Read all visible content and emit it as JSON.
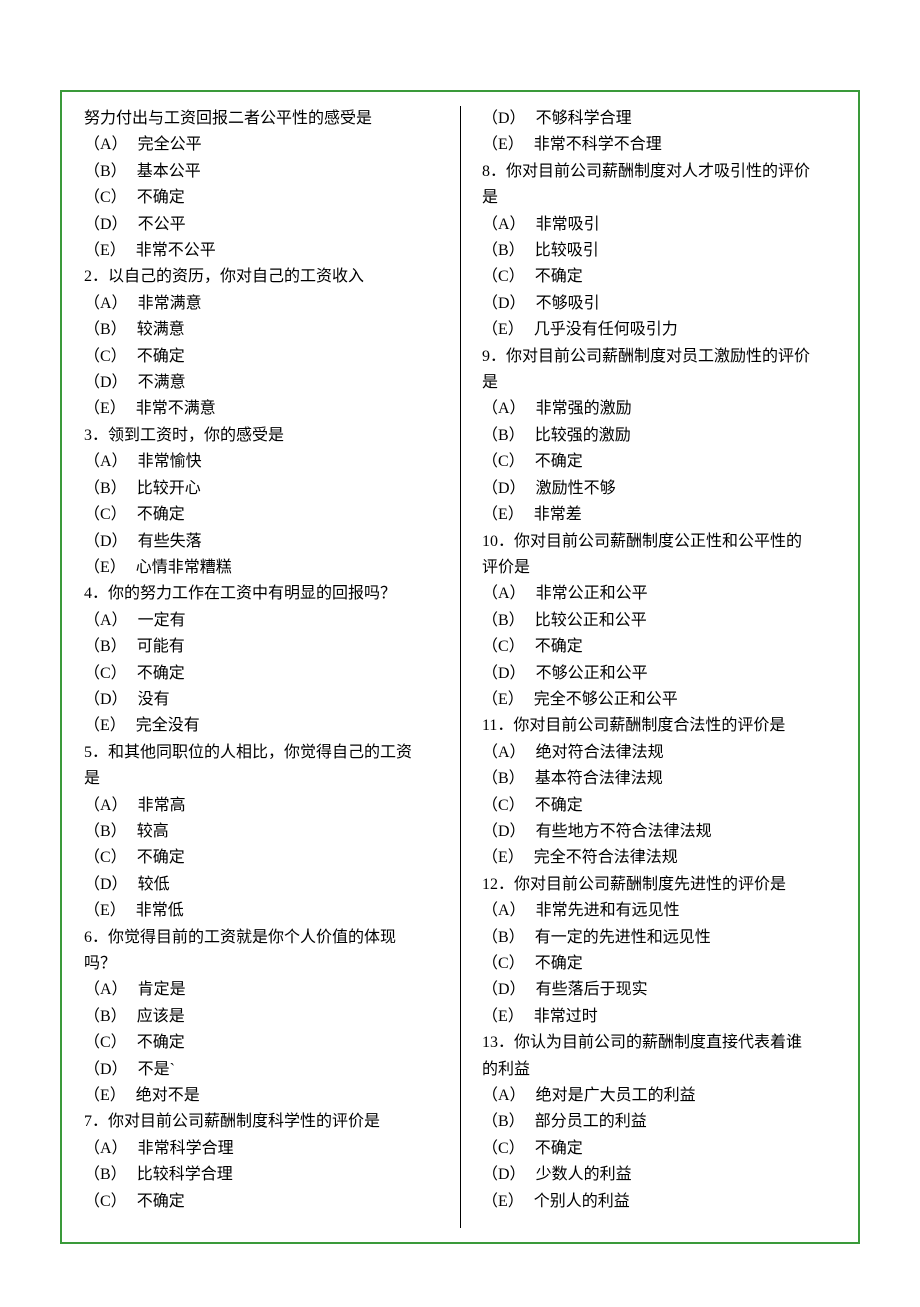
{
  "left": {
    "intro": "努力付出与工资回报二者公平性的感受是",
    "introOptions": [
      {
        "label": "（A）",
        "text": "完全公平"
      },
      {
        "label": "（B）",
        "text": "基本公平"
      },
      {
        "label": "（C）",
        "text": "不确定"
      },
      {
        "label": "（D）",
        "text": "不公平"
      },
      {
        "label": "（E）",
        "text": "非常不公平"
      }
    ],
    "q2": {
      "title": "2．以自己的资历，你对自己的工资收入",
      "options": [
        {
          "label": "（A）",
          "text": "非常满意"
        },
        {
          "label": "（B）",
          "text": "较满意"
        },
        {
          "label": "（C）",
          "text": "不确定"
        },
        {
          "label": "（D）",
          "text": "不满意"
        },
        {
          "label": "（E）",
          "text": "非常不满意"
        }
      ]
    },
    "q3": {
      "title": "3．领到工资时，你的感受是",
      "options": [
        {
          "label": "（A）",
          "text": "非常愉快"
        },
        {
          "label": "（B）",
          "text": "比较开心"
        },
        {
          "label": "（C）",
          "text": "不确定"
        },
        {
          "label": "（D）",
          "text": "有些失落"
        },
        {
          "label": "（E）",
          "text": "心情非常糟糕"
        }
      ]
    },
    "q4": {
      "title": "4．你的努力工作在工资中有明显的回报吗？",
      "options": [
        {
          "label": "（A）",
          "text": "一定有"
        },
        {
          "label": "（B）",
          "text": "可能有"
        },
        {
          "label": "（C）",
          "text": "不确定"
        },
        {
          "label": "（D）",
          "text": "没有"
        },
        {
          "label": "（E）",
          "text": "完全没有"
        }
      ]
    },
    "q5": {
      "title1": "5．和其他同职位的人相比，你觉得自己的工资",
      "title2": "是",
      "options": [
        {
          "label": "（A）",
          "text": "非常高"
        },
        {
          "label": "（B）",
          "text": "较高"
        },
        {
          "label": "（C）",
          "text": "不确定"
        },
        {
          "label": "（D）",
          "text": "较低"
        },
        {
          "label": "（E）",
          "text": "非常低"
        }
      ]
    },
    "q6": {
      "title1": "6．你觉得目前的工资就是你个人价值的体现",
      "title2": "吗？",
      "options": [
        {
          "label": "（A）",
          "text": "肯定是"
        },
        {
          "label": "（B）",
          "text": "应该是"
        },
        {
          "label": "（C）",
          "text": "不确定"
        },
        {
          "label": "（D）",
          "text": "不是`"
        },
        {
          "label": "（E）",
          "text": "绝对不是"
        }
      ]
    },
    "q7": {
      "title": "7．你对目前公司薪酬制度科学性的评价是",
      "options": [
        {
          "label": "（A）",
          "text": "非常科学合理"
        },
        {
          "label": "（B）",
          "text": "比较科学合理"
        },
        {
          "label": "（C）",
          "text": "不确定"
        }
      ]
    }
  },
  "right": {
    "q7cont": [
      {
        "label": "（D）",
        "text": "不够科学合理"
      },
      {
        "label": "（E）",
        "text": "非常不科学不合理"
      }
    ],
    "q8": {
      "title1": "8．你对目前公司薪酬制度对人才吸引性的评价",
      "title2": "是",
      "options": [
        {
          "label": "（A）",
          "text": "非常吸引"
        },
        {
          "label": "（B）",
          "text": "比较吸引"
        },
        {
          "label": "（C）",
          "text": "不确定"
        },
        {
          "label": "（D）",
          "text": "不够吸引"
        },
        {
          "label": "（E）",
          "text": "几乎没有任何吸引力"
        }
      ]
    },
    "q9": {
      "title1": "9．你对目前公司薪酬制度对员工激励性的评价",
      "title2": "是",
      "options": [
        {
          "label": "（A）",
          "text": "非常强的激励"
        },
        {
          "label": "（B）",
          "text": "比较强的激励"
        },
        {
          "label": "（C）",
          "text": "不确定"
        },
        {
          "label": "（D）",
          "text": "激励性不够"
        },
        {
          "label": "（E）",
          "text": "非常差"
        }
      ]
    },
    "q10": {
      "title1": "10．你对目前公司薪酬制度公正性和公平性的",
      "title2": "评价是",
      "options": [
        {
          "label": "（A）",
          "text": "非常公正和公平"
        },
        {
          "label": "（B）",
          "text": "比较公正和公平"
        },
        {
          "label": "（C）",
          "text": "不确定"
        },
        {
          "label": "（D）",
          "text": "不够公正和公平"
        },
        {
          "label": "（E）",
          "text": "完全不够公正和公平"
        }
      ]
    },
    "q11": {
      "title": "11．你对目前公司薪酬制度合法性的评价是",
      "options": [
        {
          "label": "（A）",
          "text": "绝对符合法律法规"
        },
        {
          "label": "（B）",
          "text": "基本符合法律法规"
        },
        {
          "label": "（C）",
          "text": "不确定"
        },
        {
          "label": "（D）",
          "text": "有些地方不符合法律法规"
        },
        {
          "label": "（E）",
          "text": "完全不符合法律法规"
        }
      ]
    },
    "q12": {
      "title": "12．你对目前公司薪酬制度先进性的评价是",
      "options": [
        {
          "label": "（A）",
          "text": "非常先进和有远见性"
        },
        {
          "label": "（B）",
          "text": "有一定的先进性和远见性"
        },
        {
          "label": "（C）",
          "text": "不确定"
        },
        {
          "label": "（D）",
          "text": "有些落后于现实"
        },
        {
          "label": "（E）",
          "text": "非常过时"
        }
      ]
    },
    "q13": {
      "title1": "13．你认为目前公司的薪酬制度直接代表着谁",
      "title2": "的利益",
      "options": [
        {
          "label": "（A）",
          "text": "绝对是广大员工的利益"
        },
        {
          "label": "（B）",
          "text": "部分员工的利益"
        },
        {
          "label": "（C）",
          "text": "不确定"
        },
        {
          "label": "（D）",
          "text": "少数人的利益"
        },
        {
          "label": "（E）",
          "text": "个别人的利益"
        }
      ]
    }
  }
}
